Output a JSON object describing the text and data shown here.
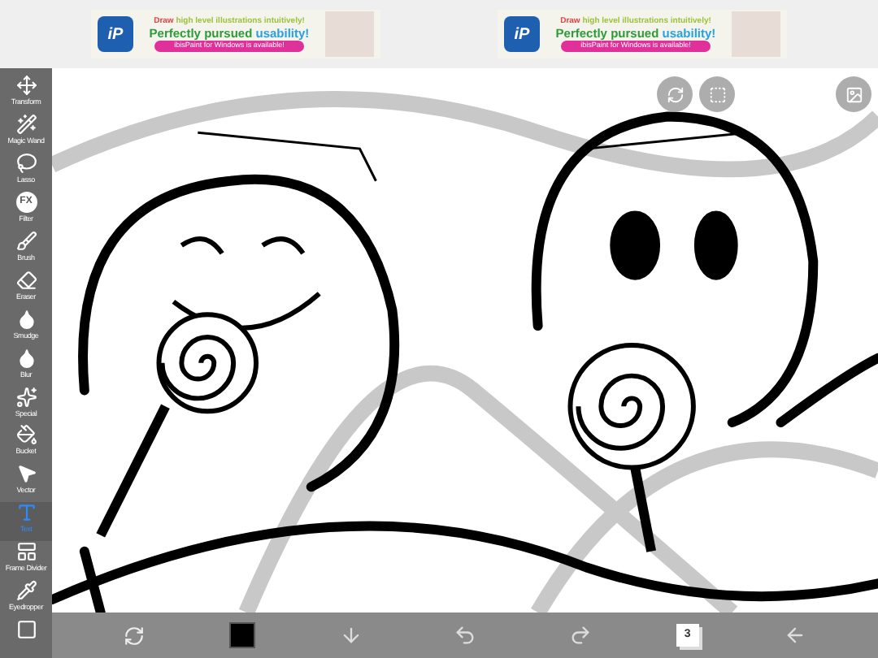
{
  "ads": [
    {
      "logo_text": "iP",
      "line_1_start": "Draw ",
      "line_1_accent": "high level illustrations intuitively!",
      "line_2_start": "Perfectly pursued ",
      "line_2_accent": "usability!",
      "banner": "ibisPaint for Windows is available!"
    },
    {
      "logo_text": "iP",
      "line_1_start": "Draw ",
      "line_1_accent": "high level illustrations intuitively!",
      "line_2_start": "Perfectly pursued ",
      "line_2_accent": "usability!",
      "banner": "ibisPaint for Windows is available!"
    }
  ],
  "tools": [
    {
      "kind": "transform",
      "label": "Transform",
      "selected": false
    },
    {
      "kind": "wand",
      "label": "Magic Wand",
      "selected": false
    },
    {
      "kind": "lasso",
      "label": "Lasso",
      "selected": false
    },
    {
      "kind": "filter",
      "label": "Filter",
      "glyph": "FX",
      "selected": false
    },
    {
      "kind": "brush",
      "label": "Brush",
      "selected": false
    },
    {
      "kind": "eraser",
      "label": "Eraser",
      "selected": false
    },
    {
      "kind": "smudge",
      "label": "Smudge",
      "selected": false
    },
    {
      "kind": "blur",
      "label": "Blur",
      "selected": false
    },
    {
      "kind": "special",
      "label": "Special",
      "selected": false
    },
    {
      "kind": "bucket",
      "label": "Bucket",
      "selected": false
    },
    {
      "kind": "vector",
      "label": "Vector",
      "selected": false
    },
    {
      "kind": "text",
      "label": "Text",
      "selected": true
    },
    {
      "kind": "frame",
      "label": "Frame Divider",
      "selected": false
    },
    {
      "kind": "eyedropper",
      "label": "Eyedropper",
      "selected": false
    },
    {
      "kind": "canvas",
      "selected": false
    }
  ],
  "bottom_bar": {
    "swatch": {
      "color": "#000000"
    },
    "layer_count": "3"
  }
}
